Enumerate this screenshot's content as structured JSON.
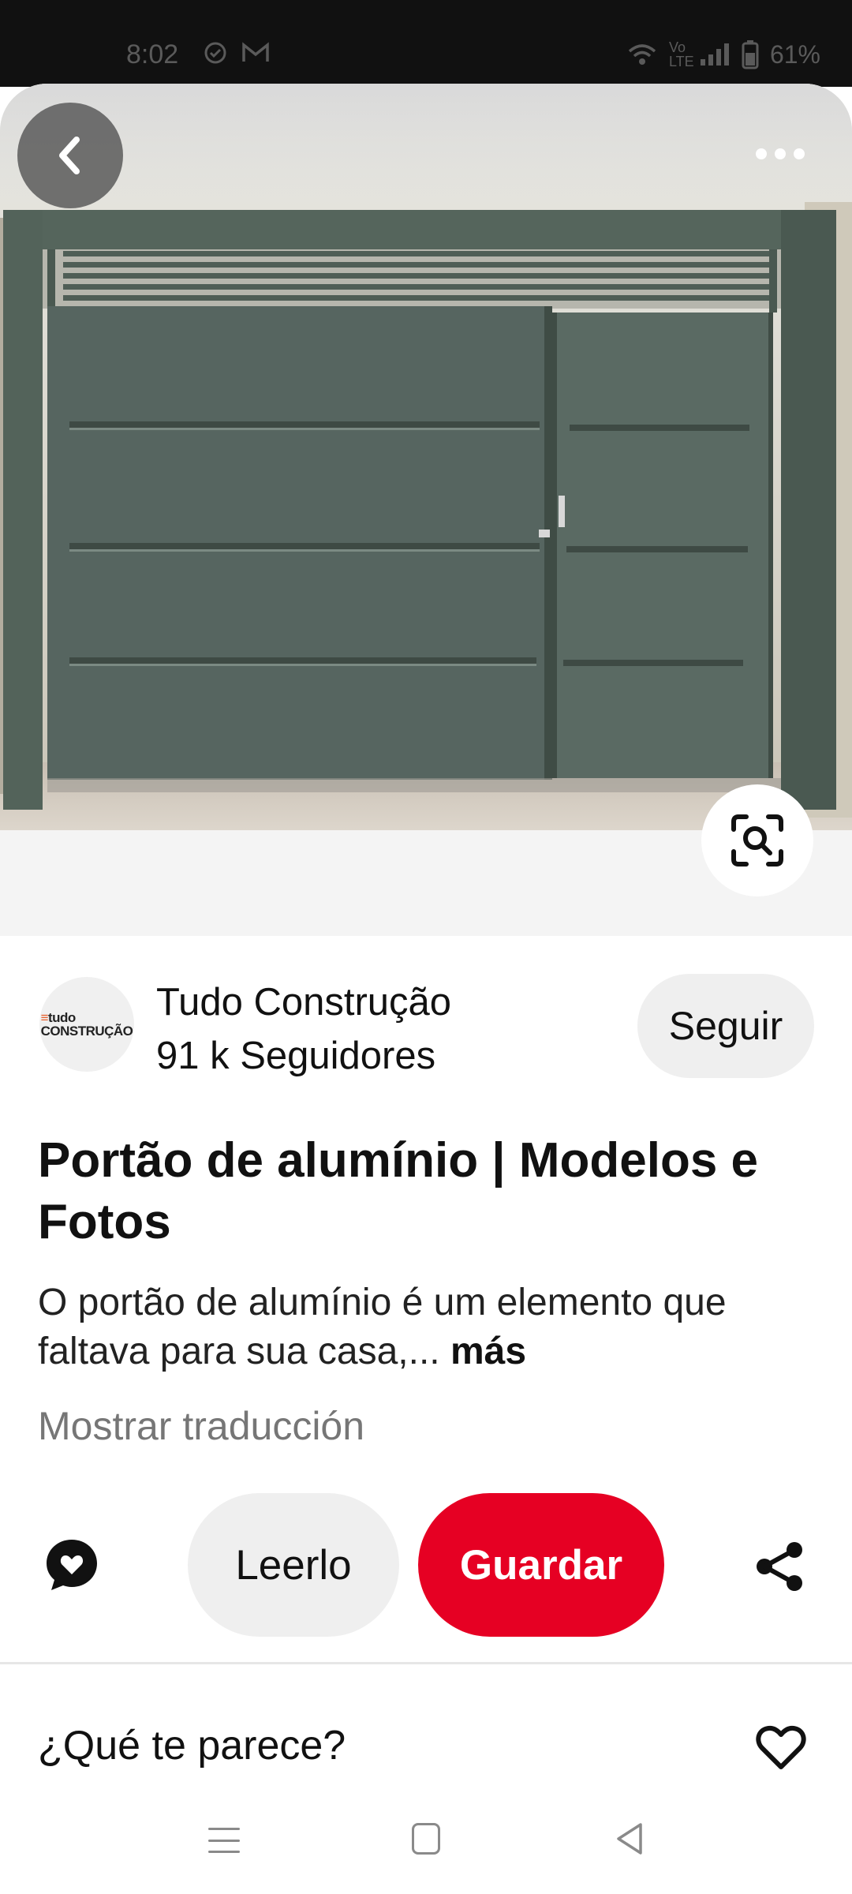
{
  "status_bar": {
    "time": "8:02",
    "battery": "61%",
    "icons": [
      "check-circle-icon",
      "gmail-icon",
      "wifi-icon",
      "volte-icon",
      "signal-icon",
      "battery-icon"
    ]
  },
  "pin": {
    "image_subject": "aluminium-gate-photo",
    "actions": {
      "back_icon": "chevron-left-icon",
      "more_icon": "more-horizontal-icon",
      "visual_search_icon": "visual-search-icon"
    }
  },
  "creator": {
    "avatar_text_top": "tudo",
    "avatar_text_bottom": "CONSTRUÇÃO",
    "name": "Tudo Construção",
    "followers": "91 k Seguidores",
    "follow_label": "Seguir"
  },
  "details": {
    "title": "Portão de alumínio | Modelos e Fotos",
    "description": "O portão de alumínio é um elemento que faltava para sua casa,...",
    "more_label": "más",
    "translate_label": "Mostrar traducción"
  },
  "actions": {
    "comment_icon": "comment-heart-icon",
    "read_label": "Leerlo",
    "save_label": "Guardar",
    "share_icon": "share-icon"
  },
  "reaction": {
    "question": "¿Qué te parece?",
    "heart_icon": "heart-outline-icon"
  },
  "navigation": {
    "items": [
      "recents-icon",
      "home-icon",
      "back-icon"
    ]
  },
  "colors": {
    "save_red": "#e60023",
    "gate_green": "#4f5e56",
    "button_gray": "#efefef",
    "muted_text": "#767676"
  }
}
